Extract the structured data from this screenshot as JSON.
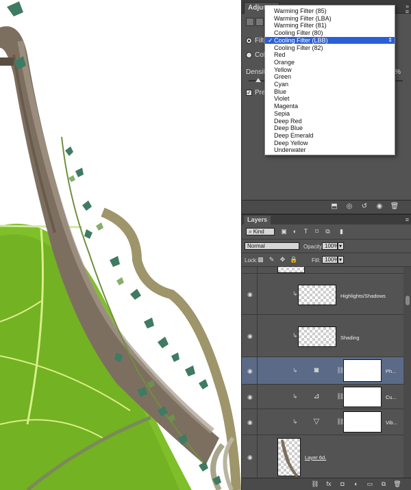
{
  "properties_panel": {
    "tab_label": "Adjustm",
    "filter_label": "Filte",
    "color_label": "Colo",
    "density_label": "Density:",
    "density_value_suffix": "%",
    "preserve_label": "Pres",
    "density_level_fraction": 0.06
  },
  "filter_dropdown": {
    "selected": "Cooling Filter (LBB)",
    "options": [
      "Warming Filter (85)",
      "Warming Filter (LBA)",
      "Warming Filter (81)",
      "Cooling Filter (80)",
      "Cooling Filter (LBB)",
      "Cooling Filter (82)",
      "Red",
      "Orange",
      "Yellow",
      "Green",
      "Cyan",
      "Blue",
      "Violet",
      "Magenta",
      "Sepia",
      "Deep Red",
      "Deep Blue",
      "Deep Emerald",
      "Deep Yellow",
      "Underwater"
    ],
    "selected_color": "#2a5fd6"
  },
  "layers_panel": {
    "tab_label": "Layers",
    "filter_kind": "Kind",
    "blend_mode": "Normal",
    "opacity_label": "Opacity:",
    "opacity_value": "100%",
    "lock_label": "Lock:",
    "fill_label": "Fill:",
    "fill_value": "100%",
    "layers": [
      {
        "name": "Highlights/Shadows"
      },
      {
        "name": "Shading"
      },
      {
        "name": "Ph..."
      },
      {
        "name": "Cu..."
      },
      {
        "name": "Vib..."
      },
      {
        "name": "Layer 6d."
      }
    ],
    "selected_color": "#5a6a87"
  }
}
